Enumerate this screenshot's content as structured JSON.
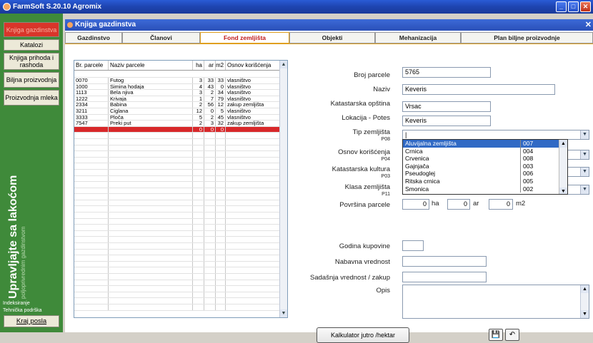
{
  "app": {
    "title": "FarmSoft S.20.10 Agromix"
  },
  "sidebar": {
    "items": [
      {
        "label": "Knjiga gazdinstva",
        "active": true
      },
      {
        "label": "Katalozi",
        "active": false
      },
      {
        "label": "Knjiga prihoda i rashoda",
        "active": false
      },
      {
        "label": "Biljna proizvodnja",
        "active": false
      },
      {
        "label": "Proizvodnja mleka",
        "active": false
      }
    ],
    "slogan": "Upravljajte sa lakoćom",
    "slogan_sub": "poljoprivrednim gazdinstvom",
    "link1": "Indeksiranje",
    "link2": "Tehnička podrška",
    "exit_label": "Kraj posla"
  },
  "window": {
    "title": "Knjiga gazdinstva"
  },
  "tabs": [
    {
      "label": "Gazdinstvo",
      "active": false
    },
    {
      "label": "Članovi",
      "active": false
    },
    {
      "label": "Fond zemljišta",
      "active": true
    },
    {
      "label": "Objekti",
      "active": false
    },
    {
      "label": "Mehanizacija",
      "active": false
    },
    {
      "label": "Plan biljne proizvodnje",
      "active": false
    }
  ],
  "grid": {
    "columns": [
      "Br. parcele",
      "Naziv parcele",
      "ha",
      "ar",
      "m2",
      "Osnov korišćenja"
    ],
    "rows": [
      [
        "0070",
        "Futog",
        "3",
        "33",
        "33",
        "vlasništvo"
      ],
      [
        "1000",
        "Simina hodaja",
        "4",
        "43",
        "0",
        "vlasništvo"
      ],
      [
        "1113",
        "Bela njiva",
        "3",
        "2",
        "34",
        "vlasništvo"
      ],
      [
        "1222",
        "Krivaja",
        "1",
        "7",
        "79",
        "vlasništvo"
      ],
      [
        "2334",
        "Babina",
        "2",
        "56",
        "12",
        "zakup zemljišta"
      ],
      [
        "3211",
        "Ciglana",
        "12",
        "0",
        "5",
        "vlasništvo"
      ],
      [
        "3333",
        "Ploča",
        "5",
        "2",
        "45",
        "vlasništvo"
      ],
      [
        "7547",
        "Preki put",
        "2",
        "3",
        "32",
        "zakup zemljišta"
      ]
    ],
    "new_row": [
      "",
      "",
      "0",
      "0",
      "0",
      ""
    ]
  },
  "form": {
    "broj_parcele_label": "Broj parcele",
    "broj_parcele": "5765",
    "naziv_label": "Naziv",
    "naziv": "Keveris",
    "kat_opstina_label": "Katastarska opština",
    "kat_opstina": "Vrsac",
    "lokacija_label": "Lokacija - Potes",
    "lokacija": "Keveris",
    "tip_label": "Tip zemljišta",
    "tip_code": "P08",
    "osnov_label": "Osnov korišćenja",
    "osnov_code": "P04",
    "kultura_label": "Katastarska kultura",
    "kultura_code": "P03",
    "klasa_label": "Klasa zemljišta",
    "klasa_code": "P11",
    "povrsina_label": "Površina parcele",
    "ha_value": "0",
    "ha_unit": "ha",
    "ar_value": "0",
    "ar_unit": "ar",
    "m2_value": "0",
    "m2_unit": "m2",
    "godina_label": "Godina kupovine",
    "nabavna_label": "Nabavna vrednost",
    "sadasnja_label": "Sadašnja vrednost / zakup",
    "opis_label": "Opis"
  },
  "dropdown": {
    "options": [
      {
        "name": "Aluvijalna zemljišta",
        "code": "007"
      },
      {
        "name": "Crnica",
        "code": "004"
      },
      {
        "name": "Crvenica",
        "code": "008"
      },
      {
        "name": "Gajnjača",
        "code": "003"
      },
      {
        "name": "Pseudoglej",
        "code": "006"
      },
      {
        "name": "Ritska crnica",
        "code": "005"
      },
      {
        "name": "Smonica",
        "code": "002"
      }
    ]
  },
  "buttons": {
    "kalkulator": "Kalkulator jutro /hektar"
  },
  "icons": {
    "save": "save-icon",
    "undo": "undo-icon"
  },
  "colors": {
    "sidebar": "#3f8a3a",
    "active_red": "#d9352a",
    "titlebar": "#2a5bd6"
  }
}
